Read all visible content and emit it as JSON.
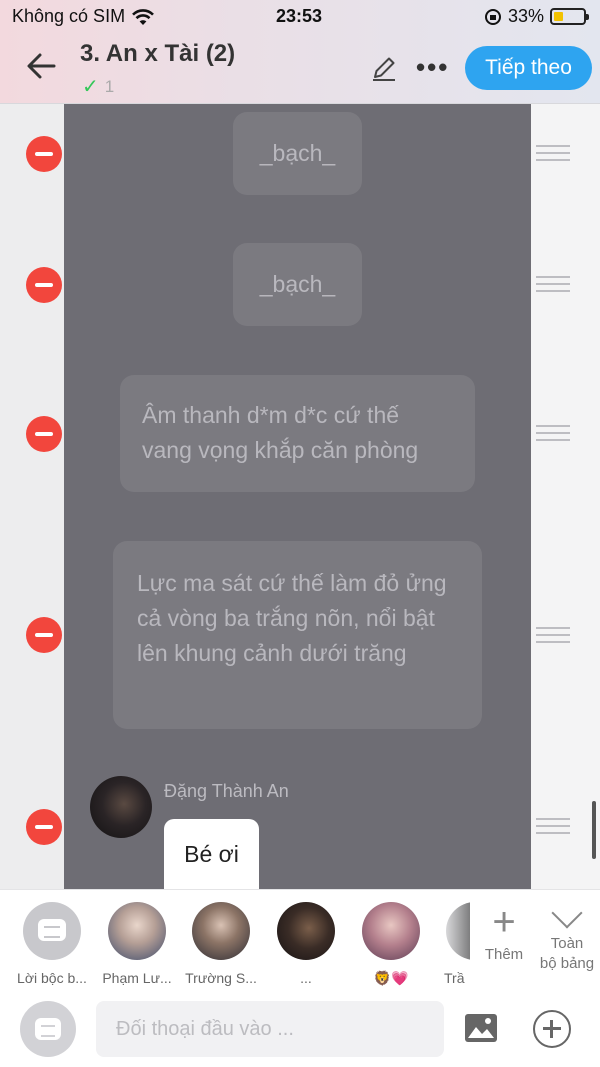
{
  "status_bar": {
    "carrier": "Không có SIM",
    "time": "23:53",
    "battery": "33%",
    "battery_level": 0.33
  },
  "header": {
    "title": "3. An x Tài (2)",
    "subtitle": "1",
    "next_label": "Tiếp theo"
  },
  "messages": [
    {
      "text": "_bạch_"
    },
    {
      "text": "_bạch_"
    },
    {
      "text": "Âm thanh d*m d*c cứ thế vang vọng khắp căn phòng"
    },
    {
      "text": "Lực ma sát cứ thế làm đỏ ửng cả vòng ba trắng nõn, nổi bật lên khung cảnh dưới trăng"
    },
    {
      "speaker": "Đặng Thành An",
      "text": "Bé ơi"
    }
  ],
  "characters": [
    {
      "name": "Lời bộc b..."
    },
    {
      "name": "Phạm Lư..."
    },
    {
      "name": "Trường S..."
    },
    {
      "name": "..."
    },
    {
      "name": "🦁💗"
    },
    {
      "name": "Trầ"
    }
  ],
  "actions": {
    "add_label": "Thêm",
    "all_label_1": "Toàn",
    "all_label_2": "bộ bảng"
  },
  "input": {
    "placeholder": "Đối thoại đầu vào ..."
  },
  "colors": {
    "accent": "#2ea4f0",
    "delete": "#f2463d",
    "panel": "#6e6d74",
    "bubble": "#7b7a80"
  }
}
